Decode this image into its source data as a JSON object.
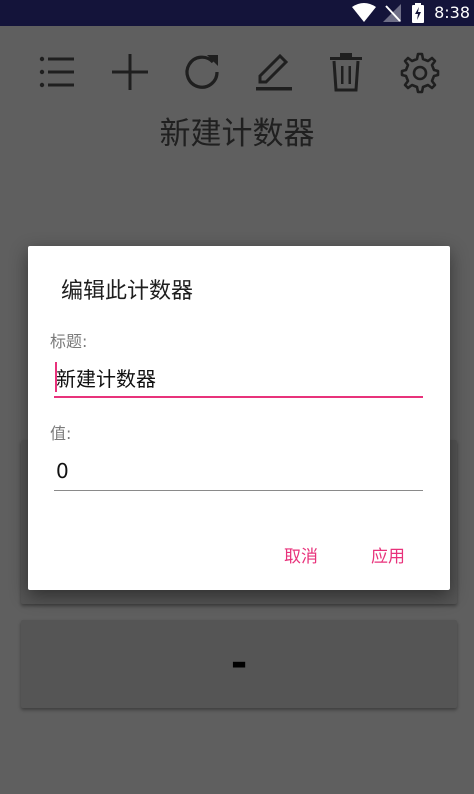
{
  "status_bar": {
    "time": "8:38",
    "icons": [
      "wifi-icon",
      "no-sim-icon",
      "battery-charging-icon"
    ]
  },
  "toolbar": {
    "icons": [
      "list-icon",
      "add-icon",
      "refresh-icon",
      "edit-icon",
      "delete-icon",
      "settings-icon"
    ]
  },
  "page": {
    "title": "新建计数器",
    "decrement_label": "-"
  },
  "dialog": {
    "title": "编辑此计数器",
    "title_field_label": "标题:",
    "title_field_value": "新建计数器",
    "value_field_label": "值:",
    "value_field_value": "0",
    "cancel_label": "取消",
    "apply_label": "应用"
  },
  "colors": {
    "accent": "#e8327b",
    "scrim_background": "#5f5f5f",
    "status_bar": "#14143a"
  }
}
